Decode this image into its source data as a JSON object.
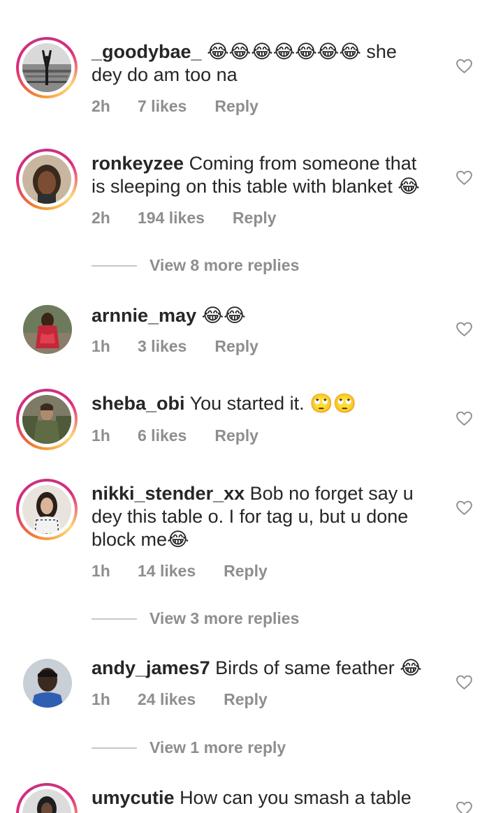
{
  "comments": [
    {
      "username": "_goodybae_",
      "text_lines": [
        "😂😂😂😂😂😂😂 she",
        "dey do am too na"
      ],
      "time": "2h",
      "likes": "7 likes",
      "reply_label": "Reply",
      "avatar": "silhouette-city",
      "story_ring": true
    },
    {
      "username": "ronkeyzee",
      "text_lines": [
        "Coming from someone that",
        "is sleeping on this table with blanket 😂"
      ],
      "time": "2h",
      "likes": "194 likes",
      "reply_label": "Reply",
      "avatar": "woman-portrait",
      "story_ring": true
    },
    {
      "username": "arnnie_may",
      "text_lines": [
        "😂😂"
      ],
      "time": "1h",
      "likes": "3 likes",
      "reply_label": "Reply",
      "avatar": "woman-red-dress",
      "story_ring": false
    },
    {
      "username": "sheba_obi",
      "text_lines": [
        "You started it. 🙄🙄"
      ],
      "time": "1h",
      "likes": "6 likes",
      "reply_label": "Reply",
      "avatar": "soldier-group",
      "story_ring": true
    },
    {
      "username": "nikki_stender_xx",
      "text_lines": [
        "Bob no forget say u",
        "dey this table o. I for tag u, but u done",
        "block me😂"
      ],
      "time": "1h",
      "likes": "14 likes",
      "reply_label": "Reply",
      "avatar": "woman-fashion",
      "story_ring": true
    },
    {
      "username": "andy_james7",
      "text_lines": [
        "Birds of same feather 😂"
      ],
      "time": "1h",
      "likes": "24 likes",
      "reply_label": "Reply",
      "avatar": "man-portrait",
      "story_ring": false
    },
    {
      "username": "umycutie",
      "text_lines": [
        "How can you smash a table"
      ],
      "avatar": "woman-dark",
      "story_ring": true
    }
  ],
  "view_replies": [
    "View 8 more replies",
    "View 3 more replies",
    "View 1 more reply"
  ],
  "colors": {
    "username": "#262626",
    "meta": "#8e8e8e",
    "divider": "#c7c7c7",
    "ring_start": "#f58529",
    "ring_end": "#dd2a7b"
  },
  "icons": {
    "like": "heart-outline-icon"
  }
}
